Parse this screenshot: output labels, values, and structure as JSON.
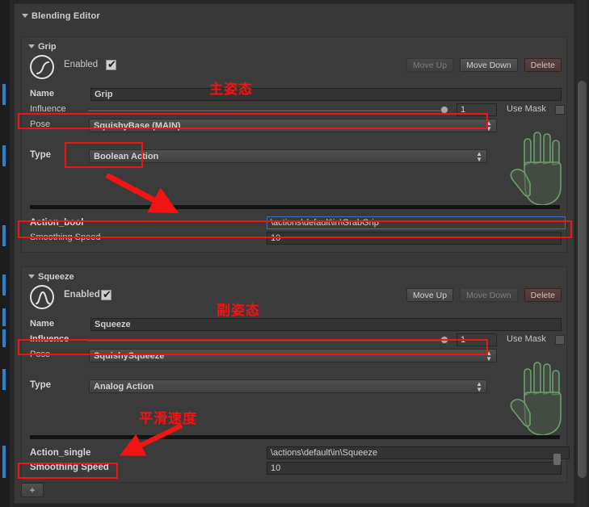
{
  "window": {
    "title": "Blending Editor",
    "add_button_label": "+"
  },
  "blends": [
    {
      "section_title": "Grip",
      "icon": "boolean-step-curve-icon",
      "enabled_label": "Enabled",
      "enabled_checked": true,
      "checkmark": "✔",
      "buttons": {
        "move_up": {
          "label": "Move Up",
          "enabled": false
        },
        "move_down": {
          "label": "Move Down",
          "enabled": true
        },
        "delete": {
          "label": "Delete",
          "enabled": true
        }
      },
      "name_label": "Name",
      "name_value": "Grip",
      "influence_label": "Influence",
      "influence_value": "1",
      "use_mask_label": "Use Mask",
      "use_mask_checked": false,
      "pose_label": "Pose",
      "pose_value": "SquishyBase (MAIN)",
      "type_label": "Type",
      "type_value": "Boolean Action",
      "action_label": "Action_bool",
      "action_value": "\\actions\\default\\in\\GrabGrip",
      "smoothing_label": "Smoothing Speed",
      "smoothing_value": "10",
      "mask_preview": "hand-mask-icon"
    },
    {
      "section_title": "Squeeze",
      "icon": "analog-bell-curve-icon",
      "enabled_label": "Enabled",
      "enabled_checked": true,
      "checkmark": "✔",
      "buttons": {
        "move_up": {
          "label": "Move Up",
          "enabled": true
        },
        "move_down": {
          "label": "Move Down",
          "enabled": false
        },
        "delete": {
          "label": "Delete",
          "enabled": true
        }
      },
      "name_label": "Name",
      "name_value": "Squeeze",
      "influence_label": "Influence",
      "influence_value": "1",
      "use_mask_label": "Use Mask",
      "use_mask_checked": false,
      "pose_label": "Pose",
      "pose_value": "SquishySqueeze",
      "type_label": "Type",
      "type_value": "Analog Action",
      "action_label": "Action_single",
      "action_value": "\\actions\\default\\in\\Squeeze",
      "smoothing_label": "Smoothing Speed",
      "smoothing_value": "10",
      "mask_preview": "hand-mask-icon"
    }
  ],
  "annotations": {
    "color": "#f21313",
    "notes": [
      {
        "text": "主姿态"
      },
      {
        "text": "副姿态"
      },
      {
        "text": "平滑速度"
      }
    ]
  },
  "colors": {
    "panel_bg": "#383838",
    "block_bg": "#3b3b3b",
    "field_bg": "#333333",
    "text": "#c8c8c8",
    "annotation_red": "#f21313",
    "mask_green": "#6d9e6d",
    "focus_blue": "#3d6fb5"
  }
}
